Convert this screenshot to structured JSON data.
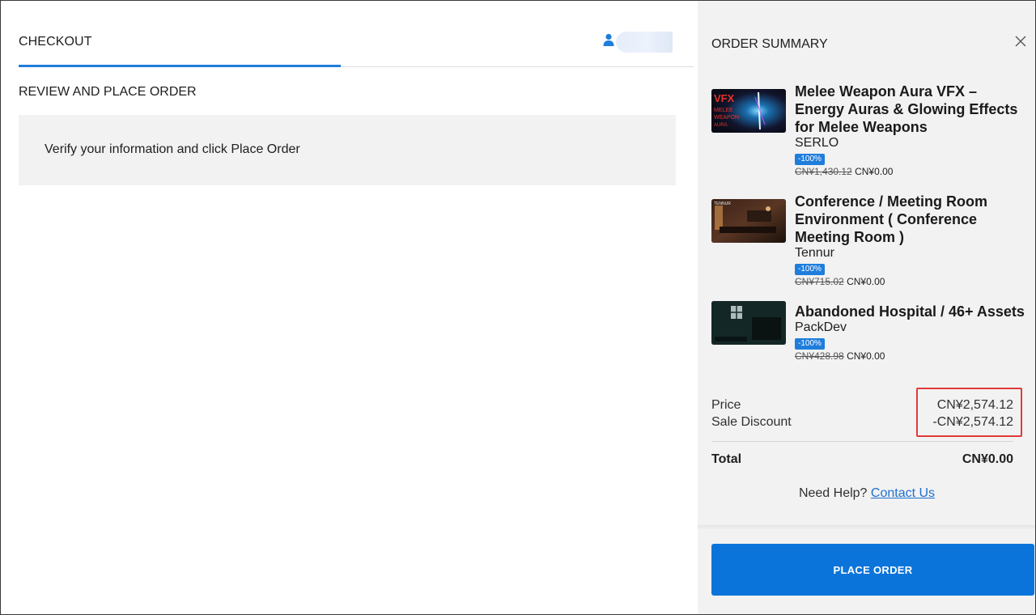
{
  "checkout": {
    "tab_label": "CHECKOUT",
    "section_title": "REVIEW AND PLACE ORDER",
    "info_message": "Verify your information and click Place Order"
  },
  "account": {
    "icon": "user-icon",
    "name_blurred": ""
  },
  "summary": {
    "title": "ORDER SUMMARY",
    "close_icon": "close-icon",
    "items": [
      {
        "title": "Melee Weapon Aura VFX – Energy Auras & Glowing Effects for Melee Weapons",
        "seller": "SERLO",
        "discount_badge": "-100%",
        "original_price": "CN¥1,430.12",
        "sale_price": "CN¥0.00",
        "thumb_text": "VFX"
      },
      {
        "title": "Conference / Meeting Room Environment ( Conference Meeting Room )",
        "seller": "Tennur",
        "discount_badge": "-100%",
        "original_price": "CN¥715.02",
        "sale_price": "CN¥0.00",
        "thumb_text": "TENNUR"
      },
      {
        "title": "Abandoned Hospital / 46+ Assets",
        "seller": "PackDev",
        "discount_badge": "-100%",
        "original_price": "CN¥428.98",
        "sale_price": "CN¥0.00",
        "thumb_text": ""
      }
    ],
    "price_label": "Price",
    "price_value": "CN¥2,574.12",
    "discount_label": "Sale Discount",
    "discount_value": "-CN¥2,574.12",
    "total_label": "Total",
    "total_value": "CN¥0.00",
    "help_text": "Need Help?",
    "help_link": "Contact Us",
    "place_order_label": "PLACE ORDER"
  },
  "colors": {
    "accent": "#0a74da",
    "badge": "#1f7ddc",
    "highlight_border": "#e23a3a",
    "panel_bg": "#f2f2f2"
  }
}
